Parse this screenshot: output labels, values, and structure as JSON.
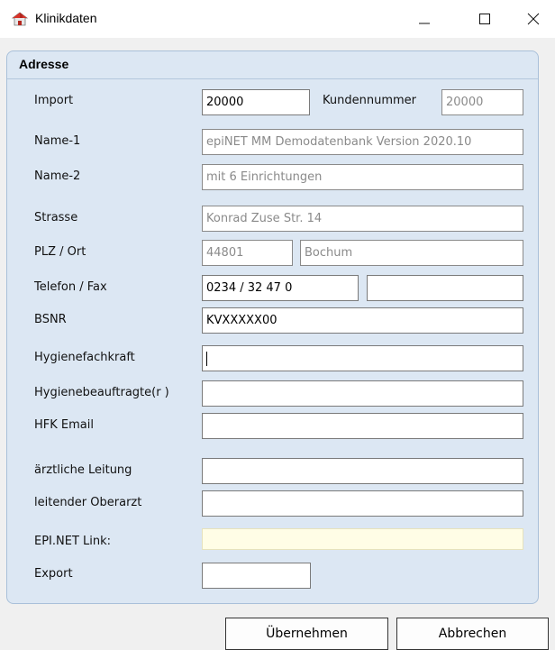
{
  "window": {
    "title": "Klinikdaten"
  },
  "section": {
    "title": "Adresse"
  },
  "fields": {
    "import_label": "Import",
    "import_value": "20000",
    "kundennummer_label": "Kundennummer",
    "kundennummer_value": "20000",
    "name1_label": "Name-1",
    "name1_value": "epiNET MM Demodatenbank Version 2020.10",
    "name2_label": "Name-2",
    "name2_value": "mit 6 Einrichtungen",
    "strasse_label": "Strasse",
    "strasse_value": "Konrad Zuse Str. 14",
    "plz_ort_label": "PLZ / Ort",
    "plz_value": "44801",
    "ort_value": "Bochum",
    "telefon_fax_label": "Telefon / Fax",
    "telefon_value": "0234 / 32 47 0",
    "fax_value": "",
    "bsnr_label": "BSNR",
    "bsnr_value": "KVXXXXX00",
    "hygienefachkraft_label": "Hygienefachkraft",
    "hygienefachkraft_value": "",
    "hygienebeauftragte_label": "Hygienebeauftragte(r )",
    "hygienebeauftragte_value": "",
    "hfk_email_label": "HFK Email",
    "hfk_email_value": "",
    "aerztliche_leitung_label": "ärztliche Leitung",
    "aerztliche_leitung_value": "",
    "leitender_oberarzt_label": "leitender Oberarzt",
    "leitender_oberarzt_value": "",
    "epinet_link_label": "EPI.NET Link:",
    "epinet_link_value": "",
    "export_label": "Export",
    "export_value": ""
  },
  "buttons": {
    "apply_label": "Übernehmen",
    "cancel_label": "Abbrechen"
  },
  "icons": {
    "app": "house-icon",
    "minimize": "minimize-icon",
    "maximize": "maximize-icon",
    "close": "close-icon"
  },
  "colors": {
    "panel_bg": "#dce7f3",
    "panel_border": "#a9c0d9",
    "link_field_bg": "#fffde6",
    "readonly_text": "#8a8a8a"
  }
}
